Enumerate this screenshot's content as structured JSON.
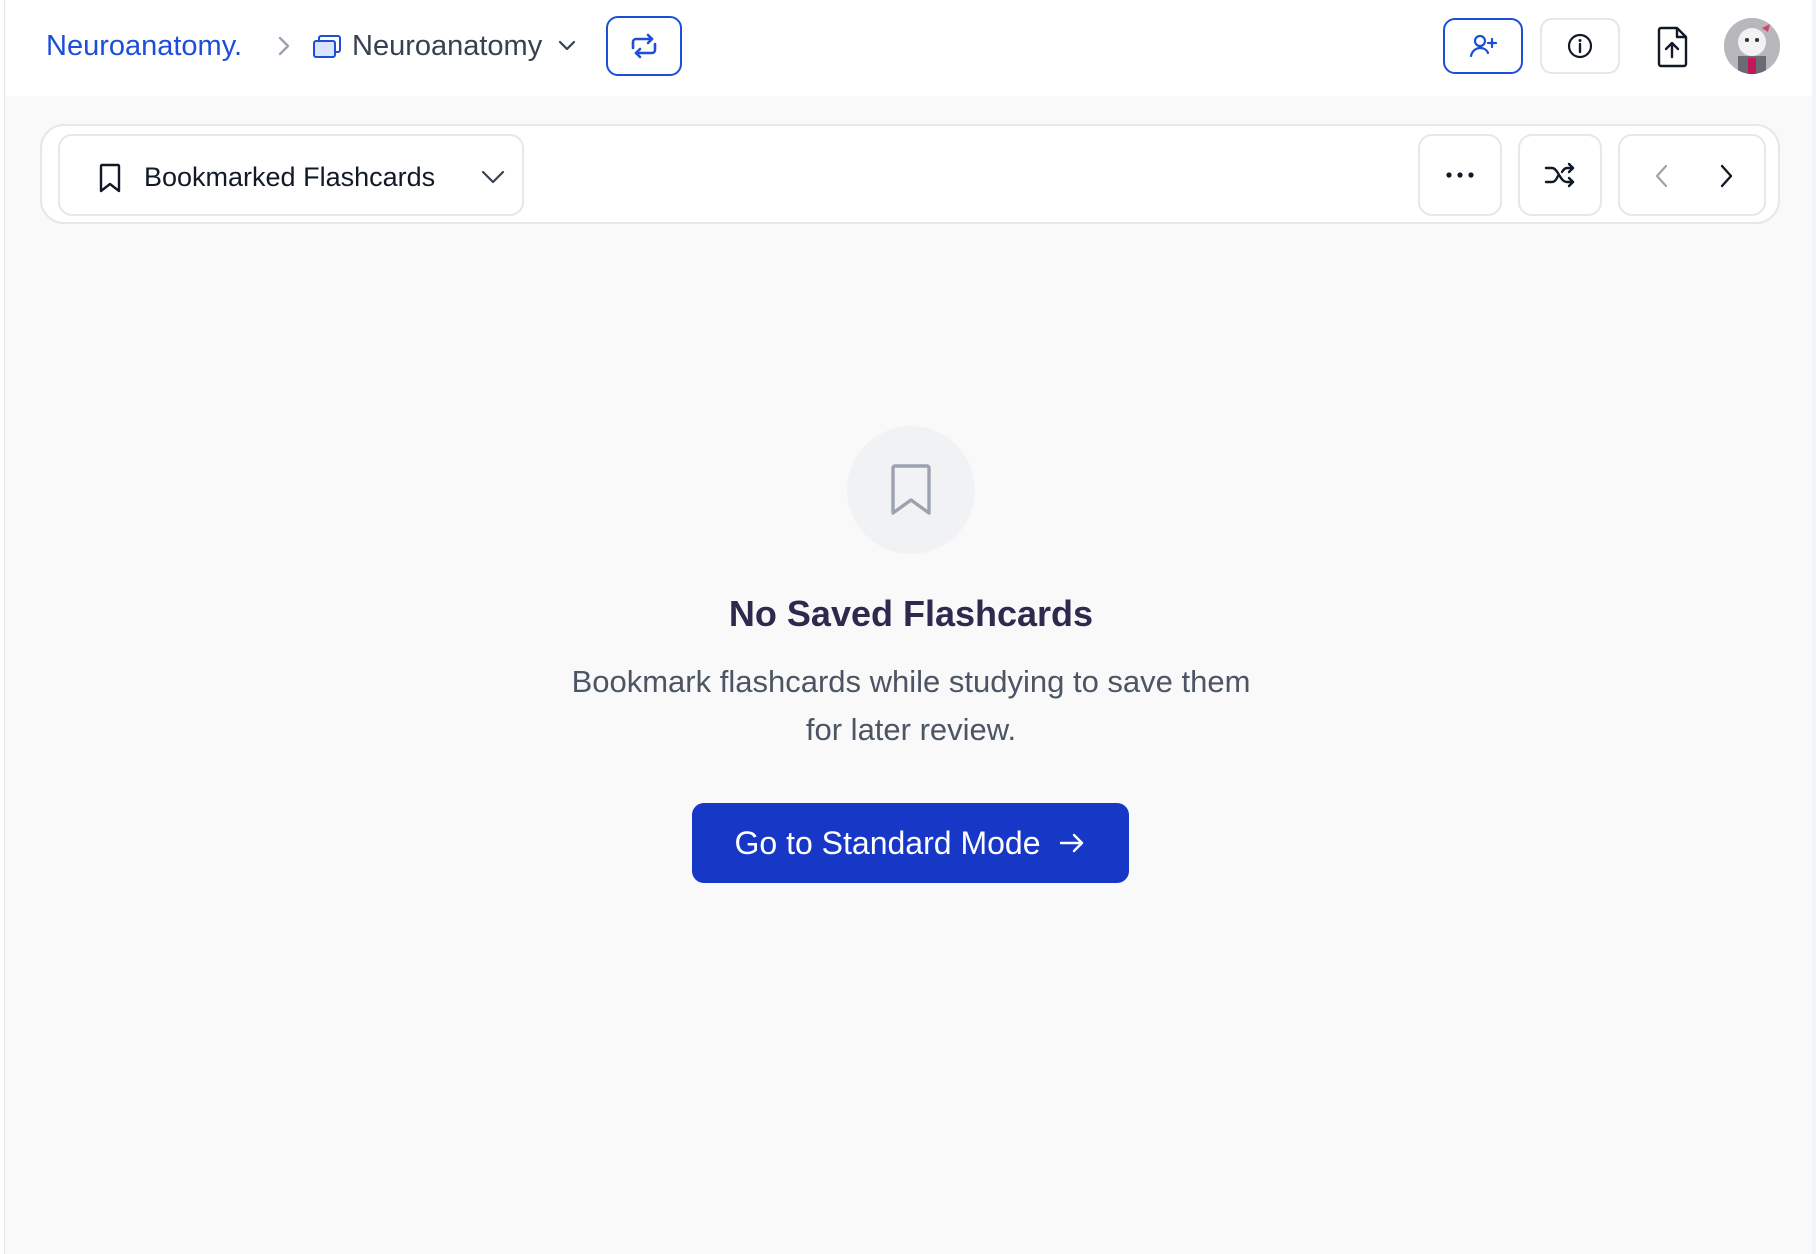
{
  "breadcrumb": {
    "root": "Neuroanatomy.",
    "deck": "Neuroanatomy"
  },
  "header": {
    "icons": [
      "chevron-right-icon",
      "deck-stack-icon",
      "chevron-down-icon",
      "switch-arrows-icon",
      "add-user-icon",
      "info-icon",
      "file-upload-icon"
    ]
  },
  "toolbar": {
    "mode_label": "Bookmarked Flashcards",
    "icons": [
      "bookmark-icon",
      "chevron-down-icon",
      "more-icon",
      "shuffle-icon",
      "chevron-left-icon",
      "chevron-right-icon"
    ]
  },
  "empty_state": {
    "title": "No Saved Flashcards",
    "description": "Bookmark flashcards while studying to save them for later review.",
    "cta_label": "Go to Standard Mode",
    "icons": [
      "bookmark-icon",
      "arrow-right-icon"
    ]
  },
  "colors": {
    "accent": "#1d4ed8",
    "cta": "#1737c7",
    "background": "#f9f9fa",
    "title": "#2e2a4d"
  }
}
